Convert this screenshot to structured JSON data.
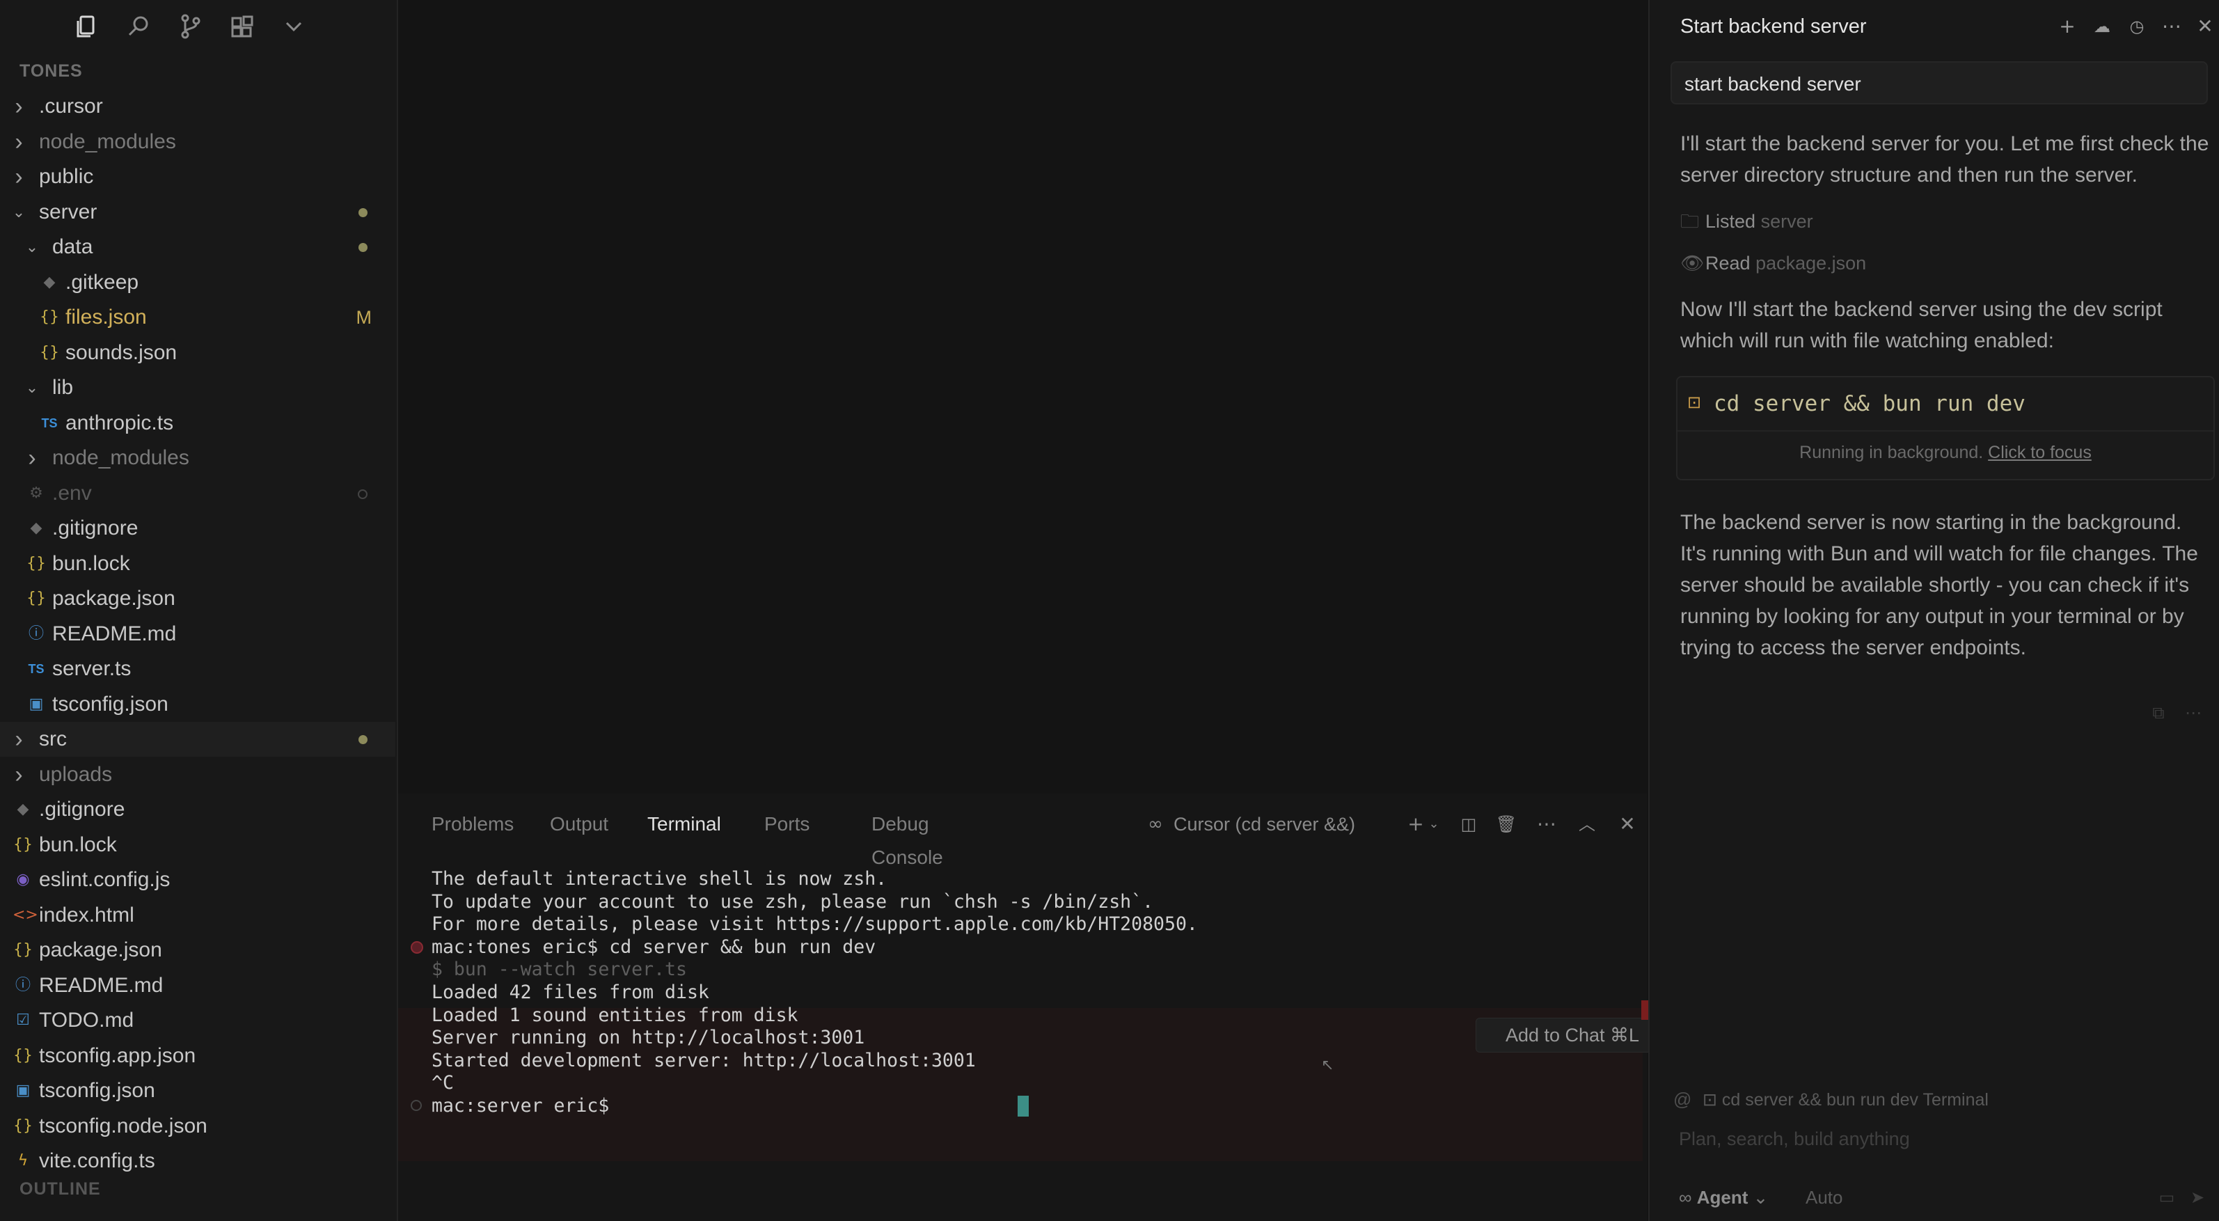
{
  "sidebar": {
    "explorer_title": "TONES",
    "outline_title": "OUTLINE",
    "tree": [
      {
        "label": ".cursor",
        "type": "folder",
        "state": "collapsed",
        "depth": 0
      },
      {
        "label": "node_modules",
        "type": "folder",
        "state": "collapsed",
        "depth": 0,
        "dim": true
      },
      {
        "label": "public",
        "type": "folder",
        "state": "collapsed",
        "depth": 0
      },
      {
        "label": "server",
        "type": "folder",
        "state": "expanded",
        "depth": 0,
        "dot": true
      },
      {
        "label": "data",
        "type": "folder",
        "state": "expanded",
        "depth": 1,
        "dot": true
      },
      {
        "label": ".gitkeep",
        "type": "file",
        "icon": "git-icon",
        "depth": 2
      },
      {
        "label": "files.json",
        "type": "file",
        "icon": "json-icon",
        "depth": 2,
        "modified": "M"
      },
      {
        "label": "sounds.json",
        "type": "file",
        "icon": "json-icon",
        "depth": 2
      },
      {
        "label": "lib",
        "type": "folder",
        "state": "expanded",
        "depth": 1
      },
      {
        "label": "anthropic.ts",
        "type": "file",
        "icon": "ts-icon",
        "depth": 2
      },
      {
        "label": "node_modules",
        "type": "folder",
        "state": "collapsed",
        "depth": 1,
        "dim": true
      },
      {
        "label": ".env",
        "type": "file",
        "icon": "gear-icon",
        "depth": 1,
        "dim": true,
        "ignored": true
      },
      {
        "label": ".gitignore",
        "type": "file",
        "icon": "git-icon",
        "depth": 1
      },
      {
        "label": "bun.lock",
        "type": "file",
        "icon": "json-icon",
        "depth": 1
      },
      {
        "label": "package.json",
        "type": "file",
        "icon": "json-icon",
        "depth": 1
      },
      {
        "label": "README.md",
        "type": "file",
        "icon": "info-icon",
        "depth": 1
      },
      {
        "label": "server.ts",
        "type": "file",
        "icon": "ts-icon",
        "depth": 1
      },
      {
        "label": "tsconfig.json",
        "type": "file",
        "icon": "tsconfig-icon",
        "depth": 1
      },
      {
        "label": "src",
        "type": "folder",
        "state": "collapsed",
        "depth": 0,
        "dot": true
      },
      {
        "label": "uploads",
        "type": "folder",
        "state": "collapsed",
        "depth": 0,
        "dim": true
      },
      {
        "label": ".gitignore",
        "type": "file",
        "icon": "git-icon",
        "depth": 0
      },
      {
        "label": "bun.lock",
        "type": "file",
        "icon": "json-icon",
        "depth": 0
      },
      {
        "label": "eslint.config.js",
        "type": "file",
        "icon": "eslint-icon",
        "depth": 0
      },
      {
        "label": "index.html",
        "type": "file",
        "icon": "html-icon",
        "depth": 0
      },
      {
        "label": "package.json",
        "type": "file",
        "icon": "json-icon",
        "depth": 0
      },
      {
        "label": "README.md",
        "type": "file",
        "icon": "info-icon",
        "depth": 0
      },
      {
        "label": "TODO.md",
        "type": "file",
        "icon": "md-icon",
        "depth": 0
      },
      {
        "label": "tsconfig.app.json",
        "type": "file",
        "icon": "json-icon",
        "depth": 0
      },
      {
        "label": "tsconfig.json",
        "type": "file",
        "icon": "tsconfig-icon",
        "depth": 0
      },
      {
        "label": "tsconfig.node.json",
        "type": "file",
        "icon": "json-icon",
        "depth": 0
      },
      {
        "label": "vite.config.ts",
        "type": "file",
        "icon": "vite-icon",
        "depth": 0
      }
    ]
  },
  "panel": {
    "tabs": [
      "Problems",
      "Output",
      "Terminal",
      "Ports",
      "Debug Console"
    ],
    "active_tab": "Terminal",
    "terminal_name": "Cursor (cd server &&)",
    "add_to_chat": "Add to Chat ⌘L",
    "terminal_lines": [
      {
        "text": "The default interactive shell is now zsh.",
        "style": "normal"
      },
      {
        "text": "To update your account to use zsh, please run `chsh -s /bin/zsh`.",
        "style": "normal"
      },
      {
        "text": "For more details, please visit https://support.apple.com/kb/HT208050.",
        "style": "normal"
      },
      {
        "text": "mac:tones eric$ cd server && bun run dev",
        "style": "normal",
        "marker": "error"
      },
      {
        "text": "$ bun --watch server.ts",
        "style": "dim"
      },
      {
        "text": "Loaded 42 files from disk",
        "style": "normal"
      },
      {
        "text": "Loaded 1 sound entities from disk",
        "style": "normal"
      },
      {
        "text": "Server running on http://localhost:3001",
        "style": "normal"
      },
      {
        "text": "Started development server: http://localhost:3001",
        "style": "normal"
      },
      {
        "text": "^C",
        "style": "normal"
      },
      {
        "text": "mac:server eric$ ",
        "style": "normal",
        "marker": "idle",
        "cursor": true
      }
    ]
  },
  "chat": {
    "title": "Start backend server",
    "user_message": "start backend server",
    "intro": "I'll start the backend server for you. Let me first check the server directory structure and then run the server.",
    "tool_calls": [
      {
        "icon": "folder-icon",
        "verb": "Listed",
        "object": "server"
      },
      {
        "icon": "eye-icon",
        "verb": "Read",
        "object": "package.json"
      }
    ],
    "middle": "Now I'll start the backend server using the dev script which will run with file watching enabled:",
    "command": "cd server && bun run dev",
    "command_status": "Running in background.",
    "command_link": "Click to focus",
    "final": "The backend server is now starting in the background. It's running with Bun and will watch for file changes. The server should be available shortly - you can check if it's running by looking for any output in your terminal or by trying to access the server endpoints.",
    "input": {
      "context_pill": "cd server && bun run dev Terminal",
      "placeholder": "Plan, search, build anything",
      "mode": "Agent",
      "model": "Auto"
    }
  },
  "colors": {
    "background": "#141414",
    "sidebar": "#181818",
    "modified": "#d2b15a",
    "terminal_cursor": "#3c8e86",
    "error_marker": "#7a1e1e"
  }
}
